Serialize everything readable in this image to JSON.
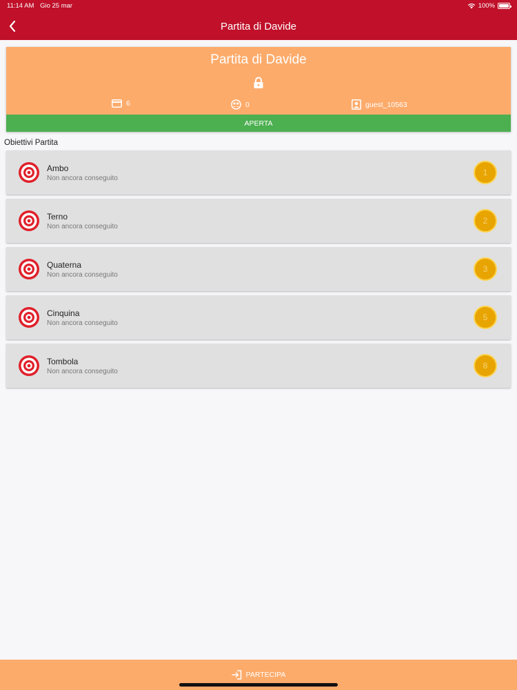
{
  "status_bar": {
    "time": "11:14 AM",
    "date": "Gio 25 mar",
    "battery": "100%"
  },
  "header": {
    "title": "Partita di Davide"
  },
  "game": {
    "name": "Partita di Davide",
    "cards_count": "6",
    "players_count": "0",
    "owner": "guest_10563",
    "state": "APERTA"
  },
  "objectives_section": {
    "title": "Obiettivi Partita"
  },
  "objectives": [
    {
      "name": "Ambo",
      "status": "Non ancora conseguito",
      "points": "1"
    },
    {
      "name": "Terno",
      "status": "Non ancora conseguito",
      "points": "2"
    },
    {
      "name": "Quaterna",
      "status": "Non ancora conseguito",
      "points": "3"
    },
    {
      "name": "Cinquina",
      "status": "Non ancora conseguito",
      "points": "5"
    },
    {
      "name": "Tombola",
      "status": "Non ancora conseguito",
      "points": "8"
    }
  ],
  "footer": {
    "join_label": "PARTECIPA"
  },
  "colors": {
    "nav_bar": "#c0102a",
    "card_bg": "#fdab6b",
    "open_state": "#4caf50",
    "badge": "#e8a400"
  }
}
